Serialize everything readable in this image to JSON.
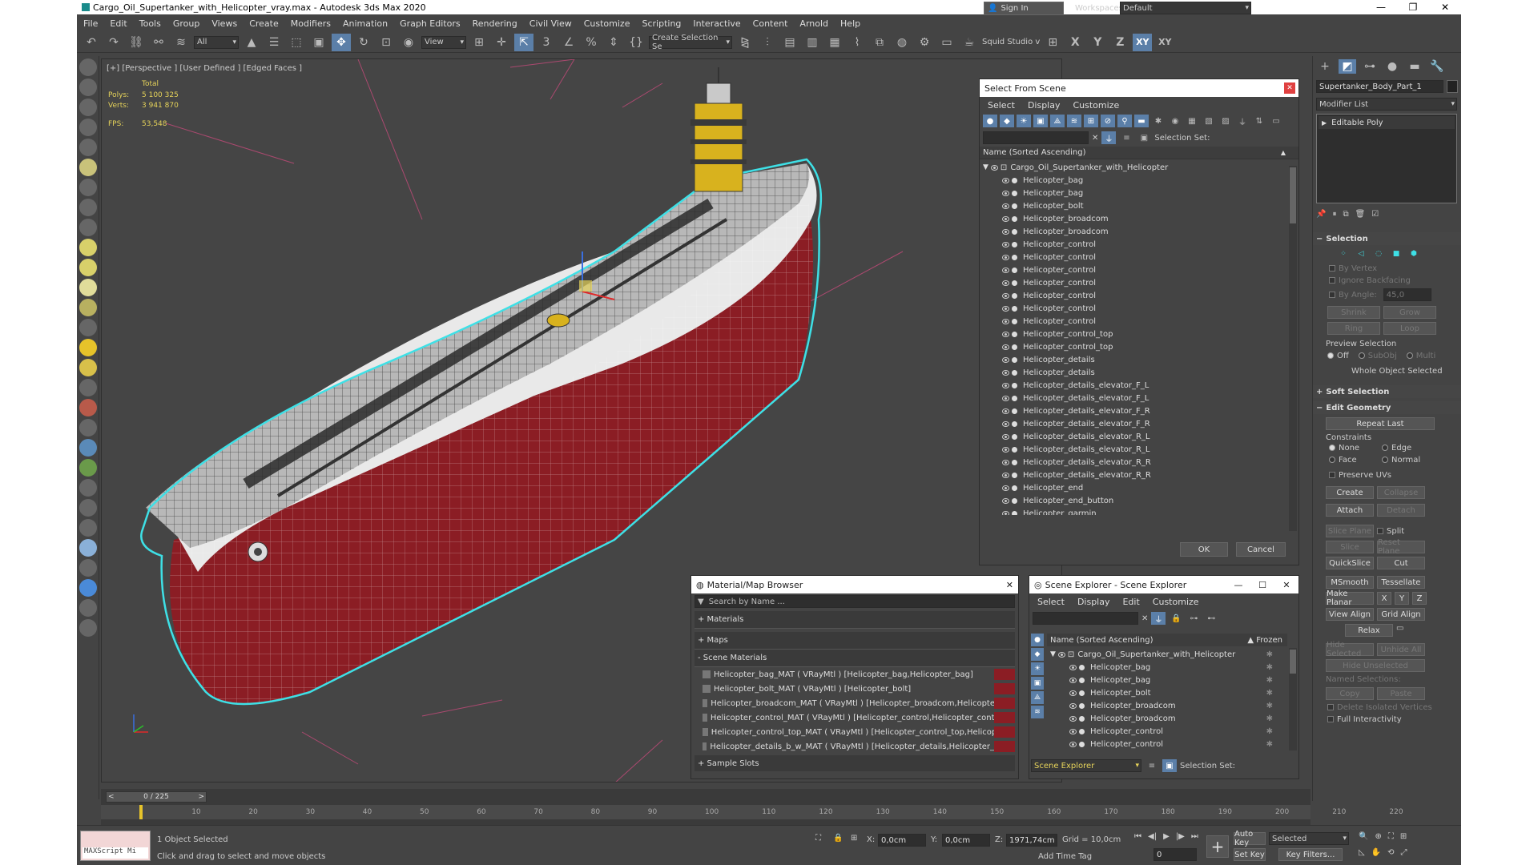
{
  "window": {
    "title": "Cargo_Oil_Supertanker_with_Helicopter_vray.max - Autodesk 3ds Max 2020",
    "controls": [
      "—",
      "❐",
      "✕"
    ]
  },
  "menu": [
    "File",
    "Edit",
    "Tools",
    "Group",
    "Views",
    "Create",
    "Modifiers",
    "Animation",
    "Graph Editors",
    "Rendering",
    "Civil View",
    "Customize",
    "Scripting",
    "Interactive",
    "Content",
    "Arnold",
    "Help"
  ],
  "signin": {
    "label": "Sign In",
    "workspaces_label": "Workspaces:",
    "workspace": "Default"
  },
  "toolbar": {
    "filter": "All",
    "refcoord": "View",
    "named_sel": "Create Selection Se",
    "squid": "Squid Studio v",
    "axis_labels": [
      "X",
      "Y",
      "Z",
      "XY",
      "XY"
    ]
  },
  "viewport": {
    "label": "[+] [Perspective ] [User Defined ] [Edged Faces ]",
    "stats": {
      "total_label": "Total",
      "polys_label": "Polys:",
      "polys": "5 100 325",
      "verts_label": "Verts:",
      "verts": "3 941 870",
      "fps_label": "FPS:",
      "fps": "53,548"
    }
  },
  "select_from_scene": {
    "title": "Select From Scene",
    "menu": [
      "Select",
      "Display",
      "Customize"
    ],
    "selection_set_label": "Selection Set:",
    "header": "Name (Sorted Ascending)",
    "root": "Cargo_Oil_Supertanker_with_Helicopter",
    "items": [
      "Helicopter_bag",
      "Helicopter_bag",
      "Helicopter_bolt",
      "Helicopter_broadcom",
      "Helicopter_broadcom",
      "Helicopter_control",
      "Helicopter_control",
      "Helicopter_control",
      "Helicopter_control",
      "Helicopter_control",
      "Helicopter_control",
      "Helicopter_control",
      "Helicopter_control_top",
      "Helicopter_control_top",
      "Helicopter_details",
      "Helicopter_details",
      "Helicopter_details_elevator_F_L",
      "Helicopter_details_elevator_F_L",
      "Helicopter_details_elevator_F_R",
      "Helicopter_details_elevator_F_R",
      "Helicopter_details_elevator_R_L",
      "Helicopter_details_elevator_R_L",
      "Helicopter_details_elevator_R_R",
      "Helicopter_details_elevator_R_R",
      "Helicopter_end",
      "Helicopter_end_button",
      "Helicopter_garmin"
    ],
    "ok": "OK",
    "cancel": "Cancel"
  },
  "material_browser": {
    "title": "Material/Map Browser",
    "search": "Search by Name ...",
    "groups": [
      "+ Materials",
      "+ Maps",
      "- Scene Materials"
    ],
    "materials": [
      "Helicopter_bag_MAT ( VRayMtl ) [Helicopter_bag,Helicopter_bag]",
      "Helicopter_bolt_MAT ( VRayMtl ) [Helicopter_bolt]",
      "Helicopter_broadcom_MAT ( VRayMtl ) [Helicopter_broadcom,Helicopter_b...",
      "Helicopter_control_MAT ( VRayMtl ) [Helicopter_control,Helicopter_control,...",
      "Helicopter_control_top_MAT ( VRayMtl ) [Helicopter_control_top,Helicopter...",
      "Helicopter_details_b_w_MAT ( VRayMtl ) [Helicopter_details,Helicopter_det..."
    ],
    "sample_slots": "+ Sample Slots"
  },
  "scene_explorer": {
    "title": "Scene Explorer - Scene Explorer",
    "menu": [
      "Select",
      "Display",
      "Edit",
      "Customize"
    ],
    "header": "Name (Sorted Ascending)",
    "frozen": "▲ Frozen",
    "root": "Cargo_Oil_Supertanker_with_Helicopter",
    "items": [
      "Helicopter_bag",
      "Helicopter_bag",
      "Helicopter_bolt",
      "Helicopter_broadcom",
      "Helicopter_broadcom",
      "Helicopter_control",
      "Helicopter_control"
    ],
    "footer_dd": "Scene Explorer",
    "selection_set_label": "Selection Set:"
  },
  "command_panel": {
    "object_name": "Supertanker_Body_Part_1",
    "modifier_list": "Modifier List",
    "stack_item": "Editable Poly",
    "selection": {
      "title": "Selection",
      "by_vertex": "By Vertex",
      "ignore_backfacing": "Ignore Backfacing",
      "by_angle": "By Angle:",
      "angle": "45,0",
      "shrink": "Shrink",
      "grow": "Grow",
      "ring": "Ring",
      "loop": "Loop",
      "preview_label": "Preview Selection",
      "off": "Off",
      "subobj": "SubObj",
      "multi": "Multi",
      "whole": "Whole Object Selected"
    },
    "soft_selection": "Soft Selection",
    "edit_geometry": {
      "title": "Edit Geometry",
      "repeat_last": "Repeat Last",
      "constraints": "Constraints",
      "none": "None",
      "edge": "Edge",
      "face": "Face",
      "normal": "Normal",
      "preserve_uvs": "Preserve UVs",
      "create": "Create",
      "collapse": "Collapse",
      "attach": "Attach",
      "detach": "Detach",
      "slice_plane": "Slice Plane",
      "split": "Split",
      "slice": "Slice",
      "reset_plane": "Reset Plane",
      "quickslice": "QuickSlice",
      "cut": "Cut",
      "msmooth": "MSmooth",
      "tessellate": "Tessellate",
      "make_planar": "Make Planar",
      "xyz": [
        "X",
        "Y",
        "Z"
      ],
      "view_align": "View Align",
      "grid_align": "Grid Align",
      "relax": "Relax",
      "hide_selected": "Hide Selected",
      "unhide_all": "Unhide All",
      "hide_unselected": "Hide Unselected",
      "named_sel": "Named Selections:",
      "copy": "Copy",
      "paste": "Paste",
      "delete_isolated": "Delete Isolated Vertices",
      "full_interactivity": "Full Interactivity"
    }
  },
  "timeline": {
    "frame": "0 / 225",
    "ticks": [
      "10",
      "20",
      "30",
      "40",
      "50",
      "60",
      "70",
      "80",
      "90",
      "100",
      "110",
      "120",
      "130",
      "140",
      "150",
      "160",
      "170",
      "180",
      "190",
      "200",
      "210",
      "220"
    ]
  },
  "status": {
    "maxscript": "MAXScript Mi",
    "objects": "1 Object Selected",
    "prompt": "Click and drag to select and move objects",
    "x_label": "X:",
    "x": "0,0cm",
    "y_label": "Y:",
    "y": "0,0cm",
    "z_label": "Z:",
    "z": "1971,74cm",
    "grid": "Grid = 10,0cm",
    "add_time_tag": "Add Time Tag",
    "auto_key": "Auto Key",
    "selected": "Selected",
    "set_key": "Set Key",
    "key_filters": "Key Filters...",
    "frame": "0"
  },
  "colors": {
    "accent": "#5b7fa8",
    "hull_red": "#8b1d24",
    "selection_cyan": "#3ee0e6",
    "deck_yellow": "#d8b21e"
  }
}
